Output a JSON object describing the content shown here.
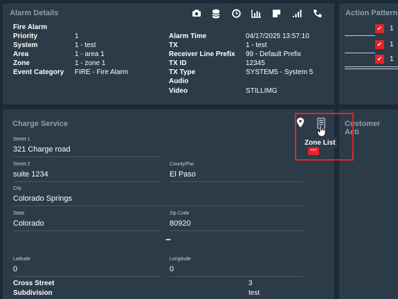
{
  "alarm_details": {
    "title": "Alarm Details",
    "header_icons": [
      "camera-icon",
      "database-icon",
      "clock-icon",
      "chart-icon",
      "note-icon",
      "signal-icon",
      "phone-icon"
    ],
    "heading": "Fire Alarm",
    "left": [
      {
        "label": "Priority",
        "value": "1"
      },
      {
        "label": "System",
        "value": "1 - test"
      },
      {
        "label": "Area",
        "value": "1 - area 1"
      },
      {
        "label": "Zone",
        "value": "1 - zone 1"
      },
      {
        "label": "Event Category",
        "value": "FIRE - Fire Alarm"
      }
    ],
    "right": [
      {
        "label": "Alarm Time",
        "value": "04/17/2025 13:57:10"
      },
      {
        "label": "TX",
        "value": "1 - test"
      },
      {
        "label": "Receiver Line Prefix",
        "value": "99 - Default Prefix"
      },
      {
        "label": "TX ID",
        "value": "12345"
      },
      {
        "label": "TX Type",
        "value": "SYSTEM5 - System 5"
      },
      {
        "label": "Audio",
        "value": ""
      },
      {
        "label": "Video",
        "value": "STILLIMG"
      }
    ]
  },
  "action_pattern": {
    "title": "Action Pattern",
    "rows": [
      {
        "value": "1"
      },
      {
        "value": "1"
      },
      {
        "value": "1"
      }
    ]
  },
  "charge_service": {
    "title": "Charge Service",
    "street1_label": "Street 1",
    "street1_value": "321 Charge road",
    "street2_label": "Street 2",
    "street2_value": "suite 1234",
    "county_label": "County/Par.",
    "county_value": "El Paso",
    "city_label": "City",
    "city_value": "Colorado Springs",
    "state_label": "State",
    "state_value": "Colorado",
    "zip_label": "Zip Code",
    "zip_value": "80920",
    "collapse_glyph": "−",
    "latitude_label": "Latitude",
    "latitude_value": "0",
    "longitude_label": "Longitude",
    "longitude_value": "0",
    "cross_street_label": "Cross Street",
    "cross_street_value": "3",
    "subdivision_label": "Subdivision",
    "subdivision_value": "test"
  },
  "customer_activity": {
    "title": "Customer Acti",
    "cursor_overlap": "C"
  },
  "zone_list_tooltip": "Zone List",
  "colors": {
    "background": "#1b2a36",
    "panel": "#2b3b47",
    "accent_red": "#e4242c",
    "muted_title": "#8ea0ad"
  }
}
